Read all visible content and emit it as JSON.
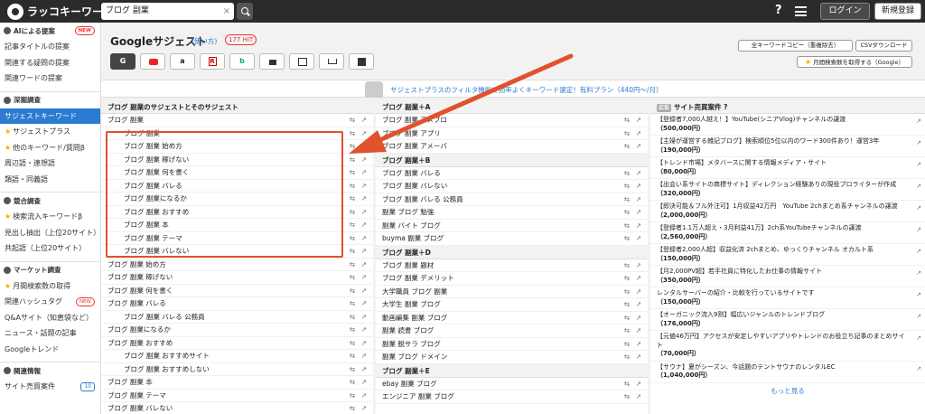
{
  "app": {
    "logo": "ラッコキーワード",
    "search_value": "ブログ 副業",
    "clear": "×",
    "help": "?",
    "login": "ログイン",
    "register": "新規登録"
  },
  "sidebar": {
    "sections": [
      {
        "head": "AIによる提案",
        "badge": "NEW",
        "items": [
          {
            "label": "記事タイトルの提案"
          },
          {
            "label": "関連する疑問の提案"
          },
          {
            "label": "関連ワードの提案"
          }
        ]
      },
      {
        "head": "深掘調査",
        "items": [
          {
            "label": "サジェストキーワード",
            "active": true
          },
          {
            "label": "サジェストプラス",
            "star": true
          },
          {
            "label": "他のキーワード/質問β",
            "star": true
          },
          {
            "label": "周辺語・連想語"
          },
          {
            "label": "類語・同義語"
          }
        ]
      },
      {
        "head": "競合調査",
        "items": [
          {
            "label": "検索流入キーワードβ",
            "star": true
          },
          {
            "label": "見出し抽出（上位20サイト）"
          },
          {
            "label": "共起語（上位20サイト）"
          }
        ]
      },
      {
        "head": "マーケット調査",
        "items": [
          {
            "label": "月間検索数の取得",
            "star": true
          },
          {
            "label": "関連ハッシュタグ",
            "badge": "NEW"
          },
          {
            "label": "Q&Aサイト（知恵袋など）"
          },
          {
            "label": "ニュース・話題の記事"
          },
          {
            "label": "Googleトレンド"
          }
        ]
      },
      {
        "head": "関連情報",
        "items": [
          {
            "label": "サイト売買案件",
            "num": "10"
          }
        ]
      }
    ]
  },
  "main": {
    "title": "Googleサジェスト",
    "howto": "(使い方)",
    "hits": "177 HIT",
    "star": "★",
    "copy": "全キーワードコピー（重複除去）",
    "csv": "CSVダウンロード",
    "volume": "月間検索数を取得する（Google）",
    "promo": "サジェストプラスのフィルタ機能で効率よくキーワード選定！有料プラン（440円〜/月）"
  },
  "tools": [
    {
      "label": "G"
    },
    {
      "label": ""
    },
    {
      "label": "a"
    },
    {
      "label": "R"
    },
    {
      "label": "b"
    },
    {
      "label": ""
    },
    {
      "label": ""
    },
    {
      "label": ""
    },
    {
      "label": ""
    }
  ],
  "col1": {
    "head": "ブログ 副業のサジェストとそのサジェスト",
    "rows": [
      {
        "t": "ブログ 副業",
        "i": 0
      },
      {
        "t": "ブログ 副業",
        "i": 1
      },
      {
        "t": "ブログ 副業 始め方",
        "i": 1
      },
      {
        "t": "ブログ 副業 稼げない",
        "i": 1
      },
      {
        "t": "ブログ 副業 何を書く",
        "i": 1
      },
      {
        "t": "ブログ 副業 バレる",
        "i": 1
      },
      {
        "t": "ブログ 副業になるか",
        "i": 1
      },
      {
        "t": "ブログ 副業 おすすめ",
        "i": 1
      },
      {
        "t": "ブログ 副業 本",
        "i": 1
      },
      {
        "t": "ブログ 副業 テーマ",
        "i": 1
      },
      {
        "t": "ブログ 副業 バレない",
        "i": 1
      },
      {
        "t": "ブログ 副業 始め方",
        "i": 0
      },
      {
        "t": "ブログ 副業 稼げない",
        "i": 0
      },
      {
        "t": "ブログ 副業 何を書く",
        "i": 0
      },
      {
        "t": "ブログ 副業 バレる",
        "i": 0
      },
      {
        "t": "ブログ 副業 バレる 公務員",
        "i": 1
      },
      {
        "t": "ブログ 副業になるか",
        "i": 0
      },
      {
        "t": "ブログ 副業 おすすめ",
        "i": 0
      },
      {
        "t": "ブログ 副業 おすすめサイト",
        "i": 1
      },
      {
        "t": "ブログ 副業 おすすめしない",
        "i": 1
      },
      {
        "t": "ブログ 副業 本",
        "i": 0
      },
      {
        "t": "ブログ 副業 テーマ",
        "i": 0
      },
      {
        "t": "ブログ 副業 バレない",
        "i": 0
      }
    ]
  },
  "col2": {
    "groups": [
      {
        "head": "ブログ 副業＋A",
        "rows": [
          "ブログ 副業 アメブロ",
          "ブログ 副業 アプリ",
          "ブログ 副業 アメーバ"
        ]
      },
      {
        "head": "ブログ 副業＋B",
        "rows": [
          "ブログ 副業 バレる",
          "ブログ 副業 バレない",
          "ブログ 副業 バレる 公務員",
          "副業 ブログ 勉強",
          "副業 バイト ブログ",
          "buyma 副業 ブログ"
        ]
      },
      {
        "head": "ブログ 副業＋D",
        "rows": [
          "ブログ 副業 題材",
          "ブログ 副業 デメリット",
          "大学職員 ブログ 副業",
          "大学生 副業 ブログ",
          "動画編集 副業 ブログ",
          "副業 読書 ブログ",
          "副業 脱サラ ブログ",
          "副業 ブログ ドメイン"
        ]
      },
      {
        "head": "ブログ 副業＋E",
        "rows": [
          "ebay 副業 ブログ",
          "エンジニア 副業 ブログ"
        ]
      }
    ]
  },
  "col3": {
    "ad_label": "広告",
    "head": "サイト売買案件",
    "info": "?",
    "more": "もっと見る",
    "items": [
      {
        "text": "【登録者7,000人越え！】YouTube(シニアVlog)チャンネルの譲渡",
        "price": "（500,000円）"
      },
      {
        "text": "【主婦が運営する雑記ブログ】検索順位5位以内のワード300件あり！運営3年",
        "price": "（190,000円）"
      },
      {
        "text": "【トレンド市場】メタバースに関する情報メディア・サイト",
        "price": "（80,000円）"
      },
      {
        "text": "【出会い系サイトの商標サイト】ディレクション経験ありの現役プロライターが作成",
        "price": "（320,000円）"
      },
      {
        "text": "【即決可能＆フル外注可】1月収益42万円　YouTube 2chまとめ系チャンネルの譲渡",
        "price": "（2,000,000円）"
      },
      {
        "text": "【登録者1.1万人超え・3月利益41万】2ch系YouTubeチャンネルの譲渡",
        "price": "（2,560,000円）"
      },
      {
        "text": "【登録者2,000人超】収益化済 2chまとめ、ゆっくりチャンネル オカルト系",
        "price": "（150,000円）"
      },
      {
        "text": "【月2,000PV超】若手社員に特化したお仕事の情報サイト",
        "price": "（350,000円）"
      },
      {
        "text": "レンタルサーバーの紹介・比較を行っているサイトです",
        "price": "（150,000円）"
      },
      {
        "text": "【オーガニック流入9割】幅広いジャンルのトレンドブログ",
        "price": "（176,000円）"
      },
      {
        "text": "【元値46万円】アクセスが安定しやすいアプリやトレンドのお役立ち記事のまとめサイト",
        "price": "（70,000円）"
      },
      {
        "text": "【サウナ】夏がシーズン、今話題のテントサウナのレンタルEC",
        "price": "（1,040,000円）"
      }
    ]
  },
  "icons": {
    "copy": "⇆",
    "open": "↗"
  },
  "colors": {
    "accent": "#2b7bd1",
    "dark": "#2b2b2b",
    "highlight": "#e2512d"
  }
}
